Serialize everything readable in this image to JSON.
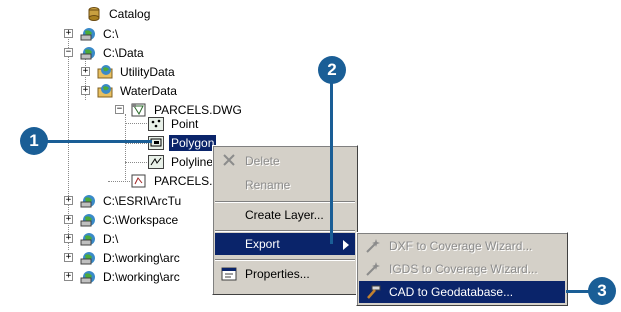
{
  "tree": {
    "root": "Catalog",
    "c_drive": "C:\\",
    "c_data": "C:\\Data",
    "utility": "UtilityData",
    "water": "WaterData",
    "parcels_dwg": "PARCELS.DWG",
    "point": "Point",
    "polygon": "Polygon",
    "polyline": "Polyline",
    "parcels2": "PARCELS.",
    "esri": "C:\\ESRI\\ArcTu",
    "workspace": "C:\\Workspace",
    "d_drive": "D:\\",
    "working1": "D:\\working\\arc",
    "working2": "D:\\working\\arc"
  },
  "context_menu": {
    "delete": "Delete",
    "rename": "Rename",
    "create_layer": "Create Layer...",
    "export": "Export",
    "properties": "Properties..."
  },
  "export_submenu": {
    "dxf": "DXF to Coverage Wizard...",
    "igds": "IGDS to Coverage Wizard...",
    "cad": "CAD to Geodatabase..."
  },
  "callouts": {
    "one": "1",
    "two": "2",
    "three": "3"
  },
  "colors": {
    "callout": "#1a5e96",
    "selection": "#0a246a",
    "menu_face": "#d4d0c8"
  }
}
